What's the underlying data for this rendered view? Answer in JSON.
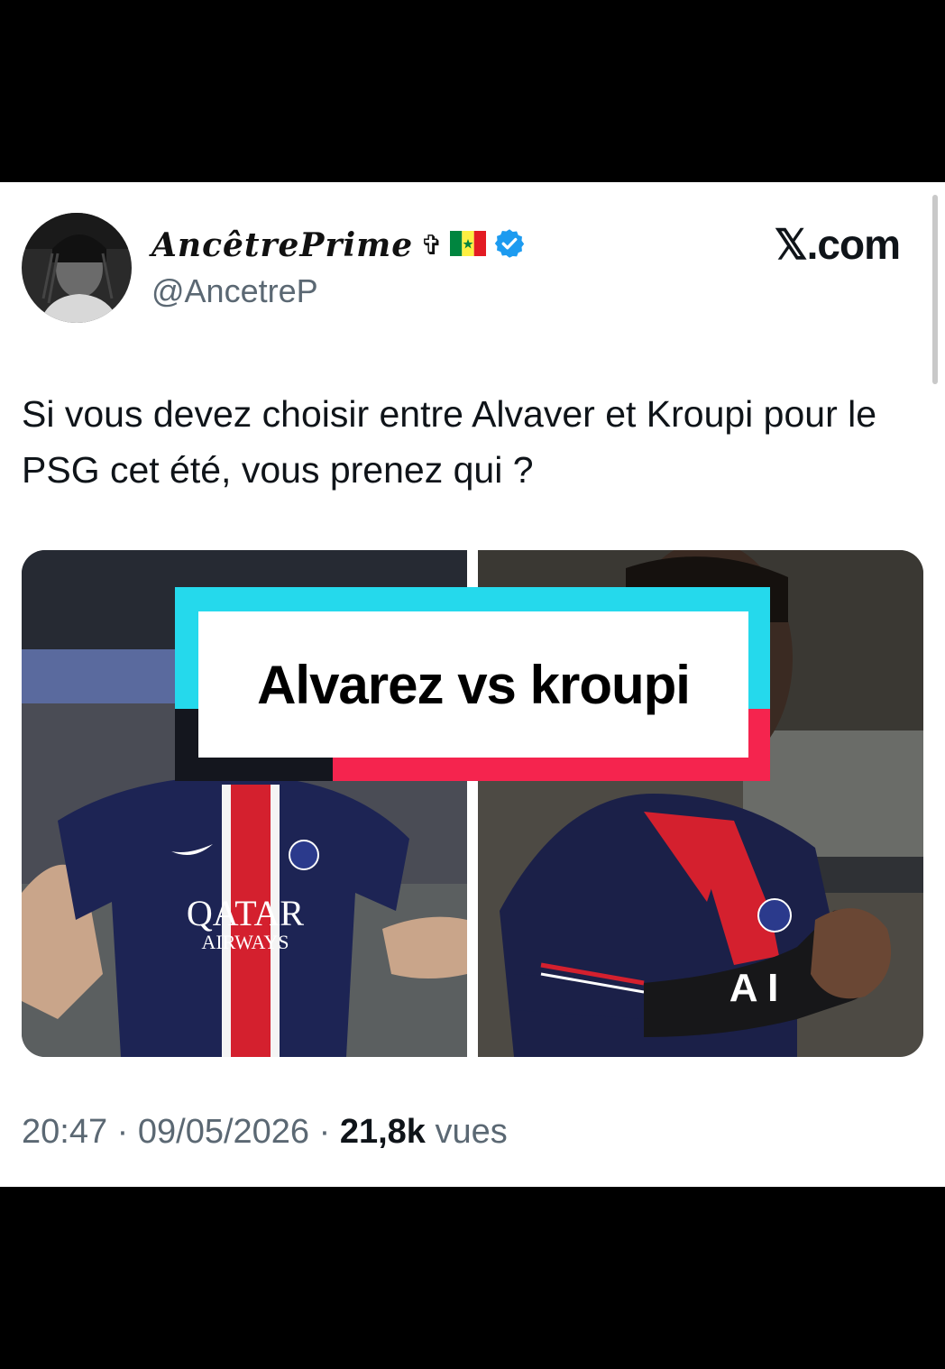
{
  "author": {
    "display_name": "AncêtrePrime",
    "cross_symbol": "✞",
    "flag_icon": "senegal-flag-icon",
    "verified_icon": "verified-badge-icon",
    "handle": "@AncetreP"
  },
  "brand": {
    "site": "𝕏.com"
  },
  "tweet": {
    "text": "Si vous devez choisir entre Alvaver et Kroupi pour le PSG cet été, vous prenez qui ?"
  },
  "media": {
    "overlay_title": "Alvarez vs kroupi",
    "left_image": {
      "sponsor_line1": "QATAR",
      "sponsor_line2": "AIRWAYS"
    },
    "right_image": {
      "sponsor_partial": "A I"
    }
  },
  "meta": {
    "time": "20:47",
    "separator": " · ",
    "date": "09/05/2026",
    "views_count": "21,8k",
    "views_label": "vues"
  },
  "colors": {
    "text": "#0f1419",
    "secondary": "#5b6873",
    "verified": "#1d9bf0",
    "overlay_cyan": "#25d9ec",
    "overlay_red": "#f5244e",
    "overlay_dark": "#14161e"
  }
}
